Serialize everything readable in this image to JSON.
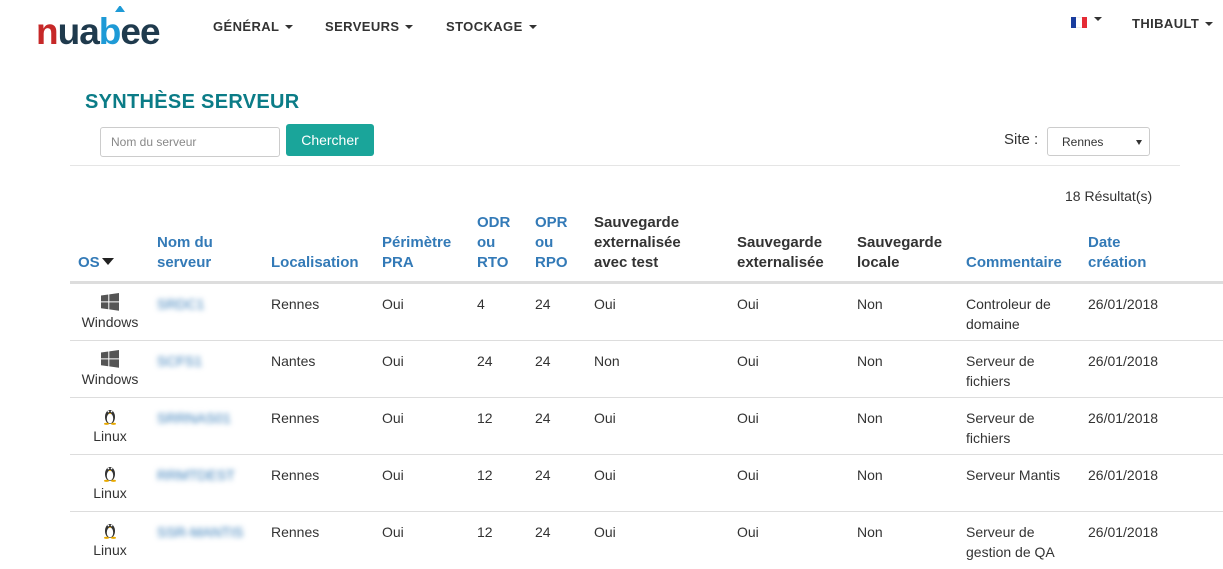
{
  "brand": {
    "name": "nuabee"
  },
  "nav": {
    "items": [
      {
        "label": "GÉNÉRAL"
      },
      {
        "label": "SERVEURS"
      },
      {
        "label": "STOCKAGE"
      }
    ],
    "user": "THIBAULT",
    "language": "fr"
  },
  "page": {
    "title": "SYNTHÈSE SERVEUR"
  },
  "search": {
    "placeholder": "Nom du serveur",
    "value": "",
    "button": "Chercher"
  },
  "site": {
    "label": "Site :",
    "selected": "Rennes"
  },
  "results": {
    "count_text": "18 Résultat(s)"
  },
  "table": {
    "headers": {
      "os": "OS",
      "nom": [
        "Nom du",
        "serveur"
      ],
      "localisation": "Localisation",
      "perimetre": [
        "Périmètre",
        "PRA"
      ],
      "odr": [
        "ODR",
        "ou",
        "RTO"
      ],
      "opr": [
        "OPR",
        "ou",
        "RPO"
      ],
      "sauv_test": [
        "Sauvegarde",
        "externalisée",
        "avec test"
      ],
      "sauv_ext": [
        "Sauvegarde",
        "externalisée"
      ],
      "sauv_loc": [
        "Sauvegarde",
        "locale"
      ],
      "commentaire": "Commentaire",
      "date": [
        "Date",
        "création"
      ]
    },
    "rows": [
      {
        "os": "Windows",
        "os_icon": "windows-icon",
        "name": "SRDC1",
        "localisation": "Rennes",
        "perimetre": "Oui",
        "rto": "4",
        "rpo": "24",
        "sauv_test": "Oui",
        "sauv_ext": "Oui",
        "sauv_loc": "Non",
        "commentaire": [
          "Controleur de",
          "domaine"
        ],
        "date": "26/01/2018"
      },
      {
        "os": "Windows",
        "os_icon": "windows-icon",
        "name": "SCFS1",
        "localisation": "Nantes",
        "perimetre": "Oui",
        "rto": "24",
        "rpo": "24",
        "sauv_test": "Non",
        "sauv_ext": "Oui",
        "sauv_loc": "Non",
        "commentaire": [
          "Serveur de",
          "fichiers"
        ],
        "date": "26/01/2018"
      },
      {
        "os": "Linux",
        "os_icon": "linux-icon",
        "name": "SRRNAS01",
        "localisation": "Rennes",
        "perimetre": "Oui",
        "rto": "12",
        "rpo": "24",
        "sauv_test": "Oui",
        "sauv_ext": "Oui",
        "sauv_loc": "Non",
        "commentaire": [
          "Serveur de",
          "fichiers"
        ],
        "date": "26/01/2018"
      },
      {
        "os": "Linux",
        "os_icon": "linux-icon",
        "name": "RRMTDEST",
        "localisation": "Rennes",
        "perimetre": "Oui",
        "rto": "12",
        "rpo": "24",
        "sauv_test": "Oui",
        "sauv_ext": "Oui",
        "sauv_loc": "Non",
        "commentaire": [
          "Serveur Mantis"
        ],
        "date": "26/01/2018"
      },
      {
        "os": "Linux",
        "os_icon": "linux-icon",
        "name": "SSR-MANTIS",
        "localisation": "Rennes",
        "perimetre": "Oui",
        "rto": "12",
        "rpo": "24",
        "sauv_test": "Oui",
        "sauv_ext": "Oui",
        "sauv_loc": "Non",
        "commentaire": [
          "Serveur de",
          "gestion de QA"
        ],
        "date": "26/01/2018"
      }
    ]
  },
  "colors": {
    "title": "#0b7c87",
    "button": "#1aa59a",
    "link": "#337ab7",
    "logo_dark": "#1f3a4d",
    "logo_red": "#c62828",
    "logo_blue": "#1e9ad6"
  }
}
